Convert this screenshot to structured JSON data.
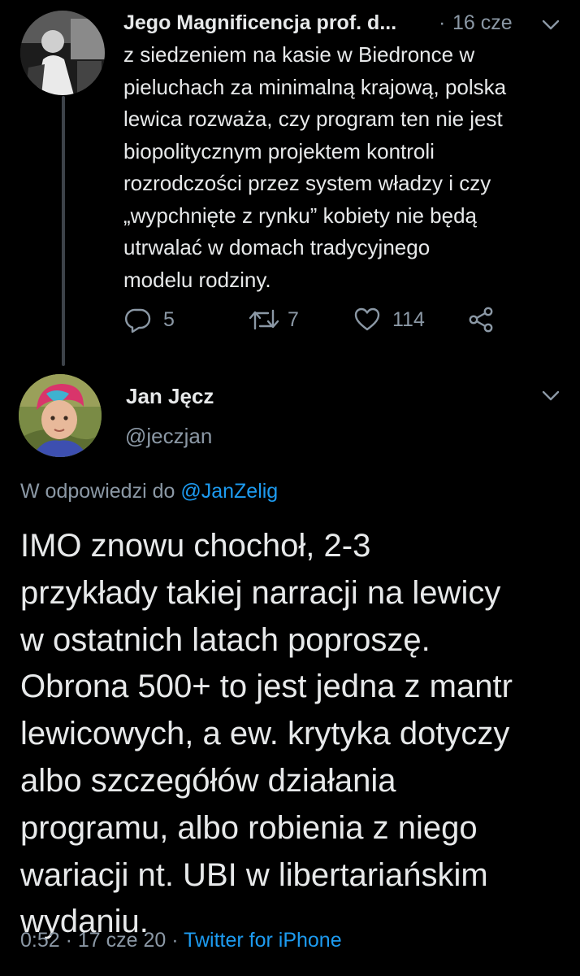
{
  "parent_tweet": {
    "author_name": "Jego Magnificencja prof. d...",
    "separator": "·",
    "date": "16 cze",
    "body_lines": [
      "z siedzeniem na kasie w Biedronce w",
      "pieluchach za minimalną krajową, polska",
      "lewica rozważa, czy program ten nie jest",
      "biopolitycznym projektem kontroli",
      "rozrodczości przez system władzy i czy",
      "„wypchnięte z rynku” kobiety nie będą",
      "utrwalać w domach tradycyjnego",
      "modelu rodziny."
    ],
    "replies": "5",
    "retweets": "7",
    "likes": "114"
  },
  "main_tweet": {
    "author_name": "Jan Jęcz",
    "handle": "@jeczjan",
    "replying_prefix": "W odpowiedzi do ",
    "replying_to": "@JanZelig",
    "body_lines": [
      "IMO znowu chochoł, 2-3",
      "przykłady takiej narracji na lewicy",
      "w ostatnich latach poproszę.",
      "Obrona 500+ to jest jedna z mantr",
      "lewicowych, a ew. krytyka dotyczy",
      "albo szczegółów działania",
      "programu, albo robienia z niego",
      "wariacji nt. UBI w libertariańskim",
      "wydaniu."
    ],
    "time": "0:52",
    "dot1": " · ",
    "date": "17 cze 20",
    "dot2": " · ",
    "source": "Twitter for iPhone"
  },
  "icons": {
    "reply": "reply-icon",
    "retweet": "retweet-icon",
    "like": "heart-icon",
    "share": "share-icon",
    "menu": "chevron-down-icon"
  },
  "colors": {
    "background": "#000000",
    "text": "#e7e9ea",
    "secondary": "#8b98a5",
    "link": "#1d9bf0"
  }
}
